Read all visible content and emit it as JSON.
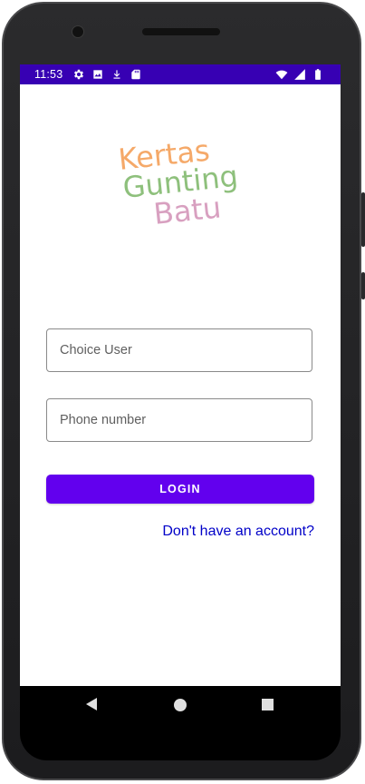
{
  "status_bar": {
    "time": "11:53",
    "left_icons": [
      "gear-icon",
      "image-icon",
      "download-icon",
      "sd-card-icon"
    ],
    "right_icons": [
      "wifi-icon",
      "signal-icon",
      "battery-icon"
    ],
    "background": "#3700b3"
  },
  "logo": {
    "line1": "Kertas",
    "line2": "Gunting",
    "line3": "Batu",
    "colors": [
      "#f5a969",
      "#8ec07c",
      "#d8a0c0"
    ]
  },
  "form": {
    "user_placeholder": "Choice User",
    "phone_placeholder": "Phone number",
    "login_label": "LOGIN",
    "signup_link": "Don't have an account?"
  },
  "theme": {
    "primary": "#6200ee",
    "link": "#0000c8"
  },
  "nav_bar": {
    "icons": [
      "back-icon",
      "home-icon",
      "recents-icon"
    ]
  }
}
